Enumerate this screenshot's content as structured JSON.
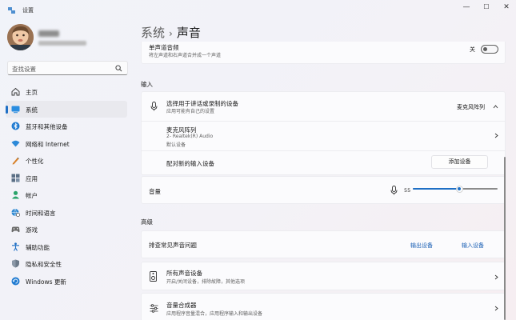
{
  "window": {
    "title": "设置",
    "minimize": "—",
    "maximize": "☐",
    "close": "✕"
  },
  "search": {
    "placeholder": "查找设置"
  },
  "nav": [
    {
      "label": "主页",
      "icon": "home-icon"
    },
    {
      "label": "系统",
      "icon": "system-icon",
      "active": true
    },
    {
      "label": "蓝牙和其他设备",
      "icon": "bluetooth-icon"
    },
    {
      "label": "网络和 Internet",
      "icon": "wifi-icon"
    },
    {
      "label": "个性化",
      "icon": "pen-icon"
    },
    {
      "label": "应用",
      "icon": "apps-icon"
    },
    {
      "label": "帐户",
      "icon": "account-icon"
    },
    {
      "label": "时间和语言",
      "icon": "globe-clock-icon"
    },
    {
      "label": "游戏",
      "icon": "gamepad-icon"
    },
    {
      "label": "辅助功能",
      "icon": "accessibility-icon"
    },
    {
      "label": "隐私和安全性",
      "icon": "shield-icon"
    },
    {
      "label": "Windows 更新",
      "icon": "update-icon"
    }
  ],
  "breadcrumb": {
    "parent": "系统",
    "separator": "›",
    "current": "声音"
  },
  "mono": {
    "title": "单声道音频",
    "desc": "将左声道和右声道合并成一个声道",
    "toggle_label": "关",
    "toggle_on": false
  },
  "input": {
    "heading": "输入",
    "select_title": "选择用于讲话或录制的设备",
    "select_desc": "应用可能有自己的设置",
    "selected_device": "麦克风阵列",
    "device_name": "麦克风阵列",
    "device_line1": "2- Realtek(R) Audio",
    "device_line2": "默认设备",
    "pair_label": "配对新的输入设备",
    "pair_button": "添加设备",
    "volume_label": "音量",
    "volume_value": "55",
    "volume_level": 0.55
  },
  "advanced": {
    "heading": "高级",
    "troubleshoot_label": "排查常见声音问题",
    "output_devices": "输出设备",
    "input_devices": "输入设备",
    "all_devices_title": "所有声音设备",
    "all_devices_desc": "开启/关闭设备，排除故障，其他选项",
    "mixer_title": "音量合成器",
    "mixer_desc": "应用程序音量混合，应用程序输入和输出设备"
  },
  "colors": {
    "accent": "#1f6fc5",
    "link": "#1a5fb4"
  }
}
